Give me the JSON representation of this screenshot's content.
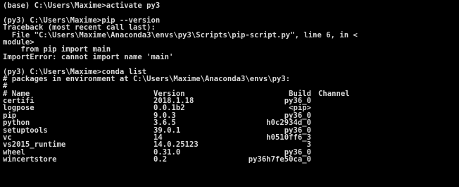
{
  "console": {
    "lines_before_table": [
      "(base) C:\\Users\\Maxime>activate py3",
      "",
      "(py3) C:\\Users\\Maxime>pip --version",
      "Traceback (most recent call last):",
      "  File \"C:\\Users\\Maxime\\Anaconda3\\envs\\py3\\Scripts\\pip-script.py\", line 6, in <",
      "module>",
      "    from pip import main",
      "ImportError: cannot import name 'main'",
      "",
      "(py3) C:\\Users\\Maxime>conda list",
      "# packages in environment at C:\\Users\\Maxime\\Anaconda3\\envs\\py3:",
      "#"
    ],
    "table_header": {
      "name": "# Name",
      "version": "Version",
      "build": "Build",
      "channel": "Channel"
    },
    "packages": [
      {
        "name": "certifi",
        "version": "2018.1.18",
        "build": "py36_0",
        "channel": ""
      },
      {
        "name": "logpose",
        "version": "0.0.1b2",
        "build": "<pip>",
        "channel": ""
      },
      {
        "name": "pip",
        "version": "9.0.3",
        "build": "py36_0",
        "channel": ""
      },
      {
        "name": "python",
        "version": "3.6.5",
        "build": "h0c2934d_0",
        "channel": ""
      },
      {
        "name": "setuptools",
        "version": "39.0.1",
        "build": "py36_0",
        "channel": ""
      },
      {
        "name": "vc",
        "version": "14",
        "build": "h0510ff6_3",
        "channel": ""
      },
      {
        "name": "vs2015_runtime",
        "version": "14.0.25123",
        "build": "3",
        "channel": ""
      },
      {
        "name": "wheel",
        "version": "0.31.0",
        "build": "py36_0",
        "channel": ""
      },
      {
        "name": "wincertstore",
        "version": "0.2",
        "build": "py36h7fe50ca_0",
        "channel": ""
      }
    ]
  },
  "colors": {
    "background": "#000000",
    "text": "#d8d8d8"
  }
}
